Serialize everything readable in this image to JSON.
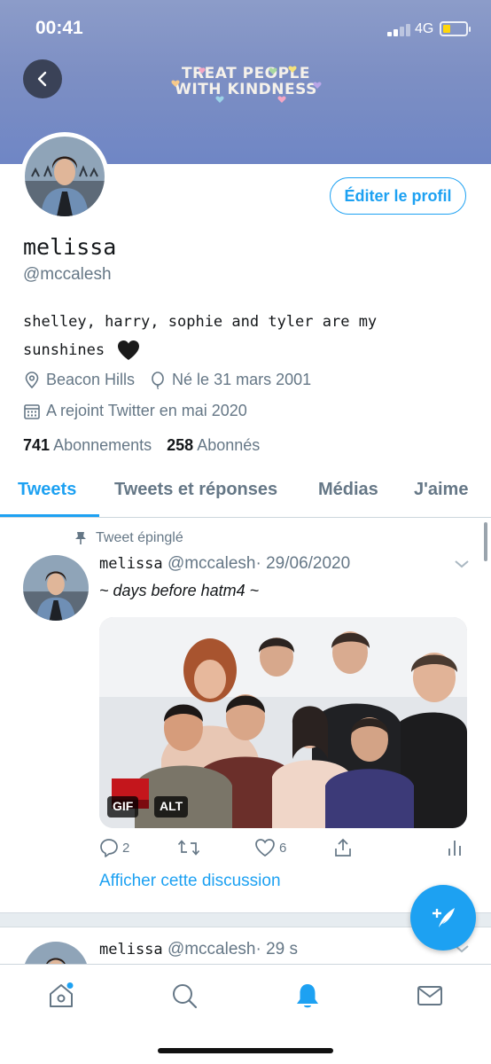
{
  "status_bar": {
    "time": "00:41",
    "network": "4G",
    "battery_level": 0.3
  },
  "banner": {
    "line1": "TREAT PEOPLE",
    "line2": "WITH KINDNESS",
    "color": "#7d8fc4"
  },
  "profile": {
    "edit_button": "Éditer le profil",
    "display_name": "melissa",
    "handle": "@mccalesh",
    "bio_line1": "shelley, harry, sophie and tyler are my",
    "bio_line2": "sunshines",
    "location": "Beacon Hills",
    "birthday": "Né le 31 mars 2001",
    "joined": "A rejoint Twitter en mai 2020",
    "following_count": "741",
    "following_label": "Abonnements",
    "followers_count": "258",
    "followers_label": "Abonnés"
  },
  "tabs": [
    {
      "label": "Tweets",
      "active": true
    },
    {
      "label": "Tweets et réponses",
      "active": false
    },
    {
      "label": "Médias",
      "active": false
    },
    {
      "label": "J'aime",
      "active": false
    }
  ],
  "tweets": [
    {
      "pinned_label": "Tweet épinglé",
      "name": "melissa",
      "handle": "@mccalesh",
      "time": "· 29/06/2020",
      "text": "~ days before hatm4 ~",
      "media_badges": {
        "gif": "GIF",
        "alt": "ALT"
      },
      "replies": "2",
      "likes": "6",
      "show_thread": "Afficher cette discussion"
    },
    {
      "name": "melissa",
      "handle": "@mccalesh",
      "time": "· 29 s"
    }
  ],
  "colors": {
    "accent": "#1da1f2",
    "secondary_text": "#657786",
    "primary_text": "#14171a"
  },
  "icons": {
    "back": "back-arrow-icon",
    "location": "location-pin-icon",
    "birthday": "balloon-icon",
    "calendar": "calendar-icon",
    "pin": "pin-icon",
    "reply": "reply-icon",
    "retweet": "retweet-icon",
    "like": "heart-icon",
    "share": "share-icon",
    "analytics": "analytics-icon",
    "compose": "compose-icon",
    "home": "home-icon",
    "search": "search-icon",
    "notifications": "bell-icon",
    "messages": "mail-icon"
  }
}
